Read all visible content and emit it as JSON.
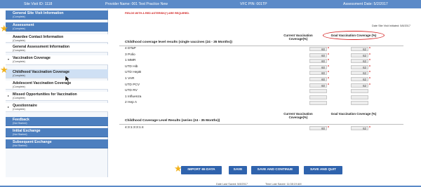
{
  "header": {
    "site_visit_id": "Site Visit ID: 1118",
    "provider_name": "Provider Name: 001 Test Practice New",
    "vfc_pin": "VFC PIN: 001TP",
    "assessment_date": "Assessment Date: 5/2/2017"
  },
  "sidebar": {
    "items": [
      {
        "label": "General Site Visit Information",
        "status": "(Complete)"
      },
      {
        "label": "Assessment",
        "status": "(Complete)"
      },
      {
        "label": "Awardee Contact Information",
        "status": "(Complete)"
      },
      {
        "label": "General Assessment Information",
        "status": "(Complete)"
      },
      {
        "label": "Vaccination Coverage",
        "status": "(Complete)"
      },
      {
        "label": "Childhood Vaccination Coverage",
        "status": "(Complete)"
      },
      {
        "label": "Adolescent Vaccination Coverage",
        "status": "(Complete)"
      },
      {
        "label": "Missed Opportunities for Vaccination",
        "status": "(Complete)"
      },
      {
        "label": "Questionnaire",
        "status": "(Complete)"
      },
      {
        "label": "Feedback",
        "status": "(Not Started)"
      },
      {
        "label": "Initial Exchange",
        "status": "(Not Started)"
      },
      {
        "label": "Subsequent Exchange",
        "status": "(Not Started)"
      }
    ]
  },
  "main": {
    "required_note": "FIELDS WITH A RED ASTERISK(*) ARE REQUIRED.",
    "date_initiated": "Date Site Visit Initiated: 5/8/2017",
    "col_current": "Current Vaccination Coverage(%)",
    "col_goal": "Goal Vaccination Coverage (%)",
    "section1_title": "Childhood coverage level results (single vaccines (24 - 35 Months))",
    "rows": [
      {
        "label": "4 DTaP",
        "current": "60",
        "goal": "62"
      },
      {
        "label": "3 Polio",
        "current": "60",
        "goal": "62"
      },
      {
        "label": "1 MMR",
        "current": "60",
        "goal": "62"
      },
      {
        "label": "UTD Hib",
        "current": "60",
        "goal": "62"
      },
      {
        "label": "UTD HepB",
        "current": "60",
        "goal": "62"
      },
      {
        "label": "1 VAR",
        "current": "60",
        "goal": "62"
      },
      {
        "label": "UTD PCV",
        "current": "60",
        "goal": "62"
      },
      {
        "label": "UTD RV",
        "current": "",
        "goal": ""
      },
      {
        "label": "1 Influenza",
        "current": "",
        "goal": ""
      },
      {
        "label": "2 Hep A",
        "current": "",
        "goal": ""
      }
    ],
    "section2_title": "Childhood Coverage Level Results (series (24 - 35 Months))",
    "series_row": {
      "label": "4:3:1:3:3:1:4",
      "current": "60",
      "goal": "62"
    },
    "asterisk": "*"
  },
  "buttons": {
    "import": "IMPORT 65 DATA",
    "save": "SAVE",
    "save_continue": "SAVE AND CONTINUE",
    "save_quit": "SAVE AND QUIT"
  },
  "footer": {
    "date_last_saved": "Date Last Saved: 5/8/2017",
    "time_last_saved": "Time Last Saved: 11:08:19 AM"
  },
  "colors": {
    "header_bar": "#5b8ac8",
    "sidebar_blue": "#4d7fbf",
    "button": "#2f63ad",
    "required": "#d02020",
    "star": "#f2b21c"
  }
}
